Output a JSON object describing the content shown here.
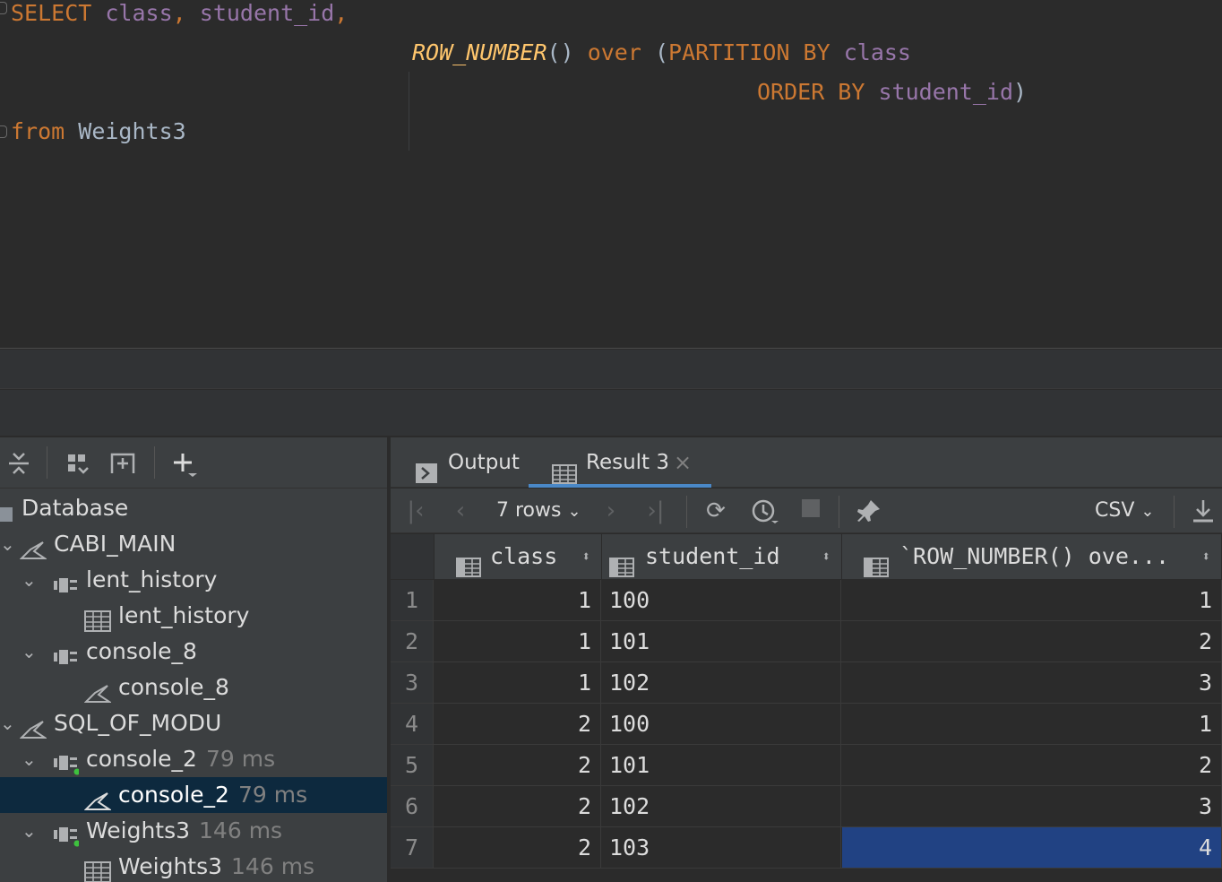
{
  "editor": {
    "line1": {
      "kw": "SELECT",
      "c1": "class",
      "comma1": ",",
      "c2": "student_id",
      "comma2": ","
    },
    "line2": {
      "fn": "ROW_NUMBER",
      "paren": "()",
      "over": "over",
      "open": "(",
      "partition": "PARTITION BY",
      "c": "class"
    },
    "line3": {
      "order": "ORDER BY",
      "c": "student_id",
      "close": ")"
    },
    "line4": {
      "from": "from",
      "table": "Weights3"
    }
  },
  "database_panel": {
    "toolbar_icons": [
      "collapse-all-icon",
      "layout-icon",
      "new-query-icon",
      "add-icon"
    ],
    "tree": [
      {
        "label": "Database",
        "time": "",
        "icon": "database-icon"
      },
      {
        "label": "CABI_MAIN",
        "time": "",
        "icon": "console-icon"
      },
      {
        "label": "lent_history",
        "time": "",
        "icon": "session-icon"
      },
      {
        "label": "lent_history",
        "time": "",
        "icon": "table-icon"
      },
      {
        "label": "console_8",
        "time": "",
        "icon": "session-icon"
      },
      {
        "label": "console_8",
        "time": "",
        "icon": "console-icon"
      },
      {
        "label": "SQL_OF_MODU",
        "time": "",
        "icon": "console-icon"
      },
      {
        "label": "console_2",
        "time": "79 ms",
        "icon": "session-active-icon"
      },
      {
        "label": "console_2",
        "time": "79 ms",
        "icon": "console-icon"
      },
      {
        "label": "Weights3",
        "time": "146 ms",
        "icon": "session-active-icon"
      },
      {
        "label": "Weights3",
        "time": "146 ms",
        "icon": "table-icon"
      }
    ]
  },
  "results": {
    "tabs": [
      {
        "label": "Output",
        "icon": "output-icon"
      },
      {
        "label": "Result 3",
        "icon": "table-icon",
        "close": "×"
      }
    ],
    "rows_label": "7 rows",
    "format_label": "CSV",
    "columns": [
      "class",
      "student_id",
      "`ROW_NUMBER() ove..."
    ],
    "rows": [
      {
        "n": "1",
        "class": "1",
        "student_id": "100",
        "rn": "1"
      },
      {
        "n": "2",
        "class": "1",
        "student_id": "101",
        "rn": "2"
      },
      {
        "n": "3",
        "class": "1",
        "student_id": "102",
        "rn": "3"
      },
      {
        "n": "4",
        "class": "2",
        "student_id": "100",
        "rn": "1"
      },
      {
        "n": "5",
        "class": "2",
        "student_id": "101",
        "rn": "2"
      },
      {
        "n": "6",
        "class": "2",
        "student_id": "102",
        "rn": "3"
      },
      {
        "n": "7",
        "class": "2",
        "student_id": "103",
        "rn": "4"
      }
    ]
  }
}
